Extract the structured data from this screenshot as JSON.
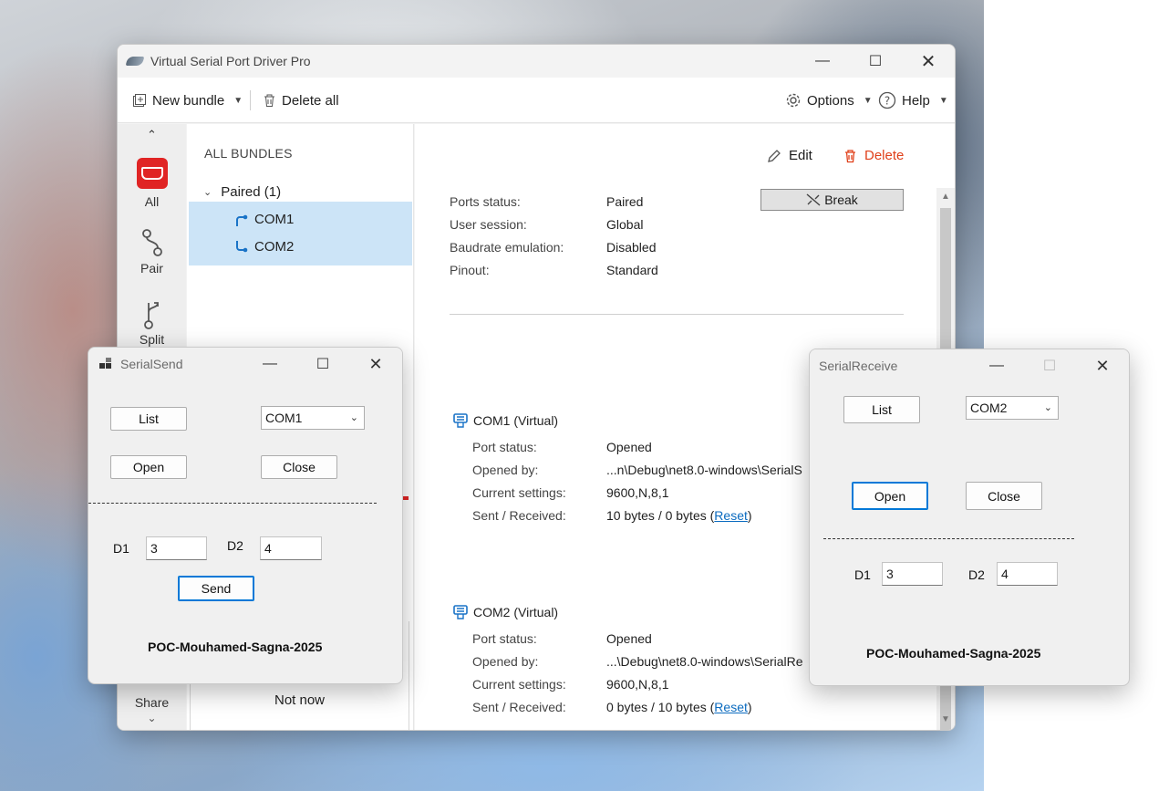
{
  "vspd": {
    "title": "Virtual Serial Port Driver Pro",
    "toolbar": {
      "new_bundle": "New bundle",
      "delete_all": "Delete all",
      "options": "Options",
      "help": "Help"
    },
    "nav": {
      "all": "All",
      "pair": "Pair",
      "split": "Split",
      "share": "Share"
    },
    "tree": {
      "heading": "ALL BUNDLES",
      "group": "Paired (1)",
      "ports": [
        "COM1",
        "COM2"
      ],
      "not_now": "Not now"
    },
    "actions": {
      "edit": "Edit",
      "delete": "Delete",
      "break": "Break"
    },
    "summary": [
      {
        "label": "Ports status:",
        "value": "Paired"
      },
      {
        "label": "User session:",
        "value": "Global"
      },
      {
        "label": "Baudrate emulation:",
        "value": "Disabled"
      },
      {
        "label": "Pinout:",
        "value": "Standard"
      }
    ],
    "com1": {
      "title": "COM1 (Virtual)",
      "rows": [
        {
          "label": "Port status:",
          "value": "Opened"
        },
        {
          "label": "Opened by:",
          "value": "...n\\Debug\\net8.0-windows\\SerialS"
        },
        {
          "label": "Current settings:",
          "value": "9600,N,8,1"
        },
        {
          "label": "Sent / Received:",
          "value": "10 bytes / 0 bytes ("
        }
      ],
      "reset": "Reset"
    },
    "com2": {
      "title": "COM2 (Virtual)",
      "rows": [
        {
          "label": "Port status:",
          "value": "Opened"
        },
        {
          "label": "Opened by:",
          "value": "...\\Debug\\net8.0-windows\\SerialRe"
        },
        {
          "label": "Current settings:",
          "value": "9600,N,8,1"
        },
        {
          "label": "Sent / Received:",
          "value": "0 bytes / 10 bytes ("
        }
      ],
      "reset": "Reset"
    },
    "paren_close": ")"
  },
  "serialsend": {
    "title": "SerialSend",
    "list_button": "List",
    "port_combo": "COM1",
    "open_button": "Open",
    "close_button": "Close",
    "d1_label": "D1",
    "d1_value": "3",
    "d2_label": "D2",
    "d2_value": "4",
    "send_button": "Send",
    "footer": "POC-Mouhamed-Sagna-2025"
  },
  "serialreceive": {
    "title": "SerialReceive",
    "list_button": "List",
    "port_combo": "COM2",
    "open_button": "Open",
    "close_button": "Close",
    "d1_label": "D1",
    "d1_value": "3",
    "d2_label": "D2",
    "d2_value": "4",
    "footer": "POC-Mouhamed-Sagna-2025"
  },
  "colors": {
    "accent_red": "#e02424",
    "selection_blue": "#cce4f7",
    "link_blue": "#0b6bbf",
    "focus_blue": "#0078d7"
  }
}
